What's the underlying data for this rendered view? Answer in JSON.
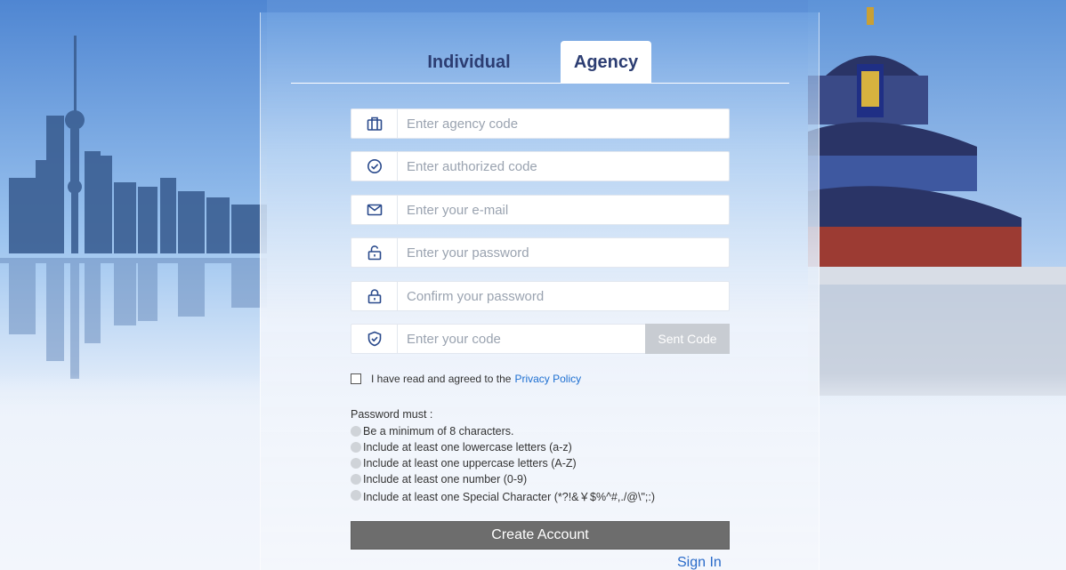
{
  "tabs": {
    "individual": "Individual",
    "agency": "Agency",
    "active": "Agency"
  },
  "form": {
    "agency_code": {
      "placeholder": "Enter agency code",
      "icon": "briefcase-icon"
    },
    "authorized_code": {
      "placeholder": "Enter authorized code",
      "icon": "check-circle-icon"
    },
    "email": {
      "placeholder": "Enter your e-mail",
      "icon": "envelope-icon"
    },
    "password": {
      "placeholder": "Enter your password",
      "icon": "unlock-icon"
    },
    "confirm_password": {
      "placeholder": "Confirm your password",
      "icon": "lock-icon"
    },
    "code": {
      "placeholder": "Enter your code",
      "icon": "shield-check-icon"
    },
    "sent_code_label": "Sent Code"
  },
  "agreement": {
    "text": "I have read and agreed to the",
    "link": "Privacy Policy"
  },
  "password_rules": {
    "title": "Password must :",
    "items": [
      "Be a minimum of 8 characters.",
      "Include at least one lowercase letters (a-z)",
      "Include at least one uppercase letters (A-Z)",
      "Include at least one number (0-9)",
      "Include at least one Special Character (*?!&￥$%^#,./@\\\";:)"
    ]
  },
  "actions": {
    "create_account": "Create Account",
    "sign_in": "Sign In"
  },
  "colors": {
    "tab_text": "#2c3d72",
    "icon": "#2a4a8c",
    "link": "#1d6fd1",
    "create_button": "#6d6d6d",
    "sent_code_button": "#c8ccd2"
  }
}
